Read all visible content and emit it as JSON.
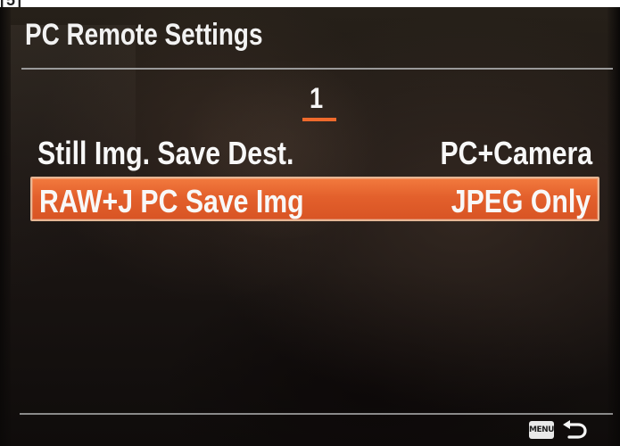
{
  "window": {
    "top_crop_text": "[5]"
  },
  "header": {
    "title": "PC Remote Settings",
    "page_number": "1"
  },
  "menu": {
    "items": [
      {
        "label": "Still Img. Save Dest.",
        "value": "PC+Camera",
        "selected": false
      },
      {
        "label": "RAW+J PC Save Img",
        "value": "JPEG Only",
        "selected": true
      }
    ]
  },
  "footer": {
    "menu_key_label": "MENU",
    "back_icon": "return-arrow-icon"
  },
  "colors": {
    "background": "#1d1714",
    "selected_row": "#e3602c",
    "page_indicator": "#ef6a2c",
    "text": "#f8f8f8",
    "divider": "#9a9a9a"
  }
}
